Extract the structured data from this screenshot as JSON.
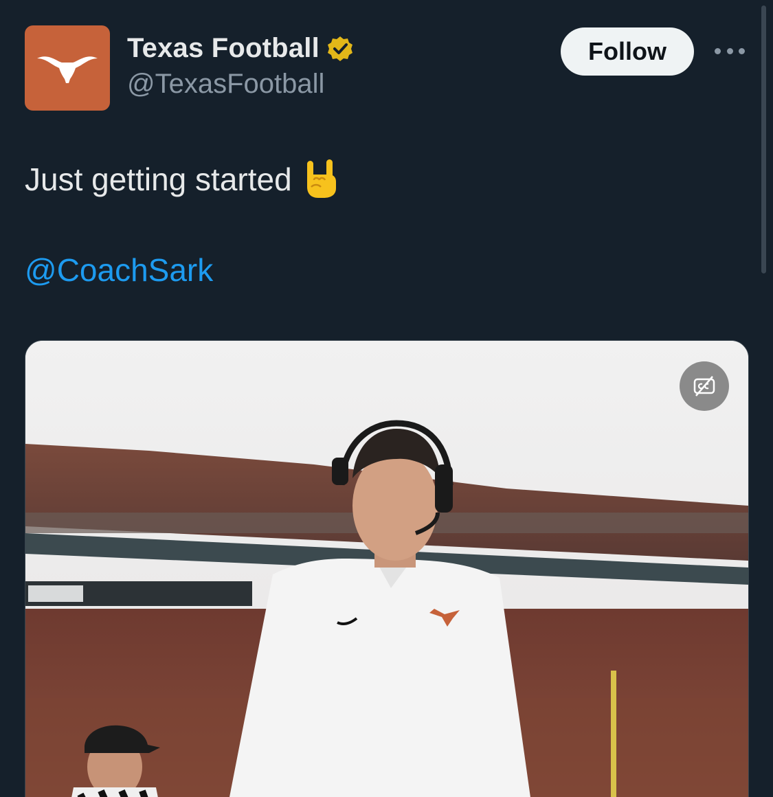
{
  "account": {
    "display_name": "Texas Football",
    "handle": "@TexasFootball",
    "avatar_icon": "longhorn-logo-icon",
    "verified_icon": "verified-badge-icon",
    "brand_color": "#c6623a",
    "verified_color": "#e2b719"
  },
  "actions": {
    "follow_label": "Follow",
    "more_icon": "more-options-icon"
  },
  "tweet": {
    "text": "Just getting started",
    "emoji_icon": "sign-of-the-horns-emoji",
    "mention": "@CoachSark",
    "mention_color": "#1d9bf0"
  },
  "media": {
    "type": "video",
    "captions_icon": "captions-off-icon"
  }
}
